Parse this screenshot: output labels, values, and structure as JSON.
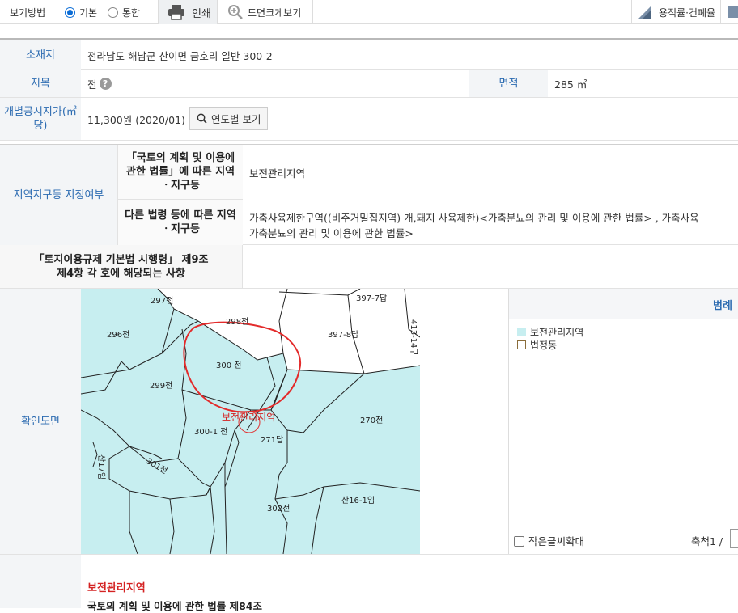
{
  "toolbar": {
    "view_mode_label": "보기방법",
    "radio_basic": "기본",
    "radio_combined": "통합",
    "print_label": "인쇄",
    "zoom_label": "도면크게보기",
    "ratio_label": "용적률·건폐율"
  },
  "info": {
    "location_label": "소재지",
    "location_value": "전라남도 해남군 산이면 금호리 일반 300-2",
    "land_category_label": "지목",
    "land_category_value": "전",
    "area_label": "면적",
    "area_value": "285 ㎡",
    "price_label": "개별공시지가(㎡당)",
    "price_value": "11,300원 (2020/01)",
    "by_year_button": "연도별 보기",
    "zone_label": "지역지구등 지정여부",
    "national_law_label": "「국토의 계획 및 이용에 관한 법률」에 따른 지역ㆍ지구등",
    "national_law_value": "보전관리지역",
    "other_law_label": "다른 법령 등에 따른 지역ㆍ지구등",
    "other_law_value_line1": "가축사육제한구역((비주거밀집지역) 개,돼지 사육제한)<가축분뇨의 관리 및 이용에 관한 법률> , 가축사육",
    "other_law_value_line2": "가축분뇨의 관리 및 이용에 관한 법률>",
    "enforcement_label": "「토지이용규제 기본법 시행령」 제9조제4항 각 호에 해당되는 사항",
    "enforcement_value": ""
  },
  "map_section": {
    "label": "확인도면",
    "zone_text": "보전관리지역",
    "parcels": [
      "297전",
      "298전",
      "397-7답",
      "397-8답",
      "413-14구",
      "296전",
      "300 전",
      "299전",
      "300-1 전",
      "271답",
      "270전",
      "산17임",
      "301전",
      "302전",
      "산16-1임"
    ]
  },
  "legend": {
    "title": "범례",
    "items": [
      {
        "label": "보전관리지역",
        "color": "#c7eef0"
      },
      {
        "label": "법정동",
        "color": "#ffffff"
      }
    ],
    "small_text_label": "작은글씨확대",
    "scale_label": "축척1 /"
  },
  "footer": {
    "zone_title": "보전관리지역",
    "law_text": "국토의 계획 및 이용에 관한 법률 제84조"
  }
}
